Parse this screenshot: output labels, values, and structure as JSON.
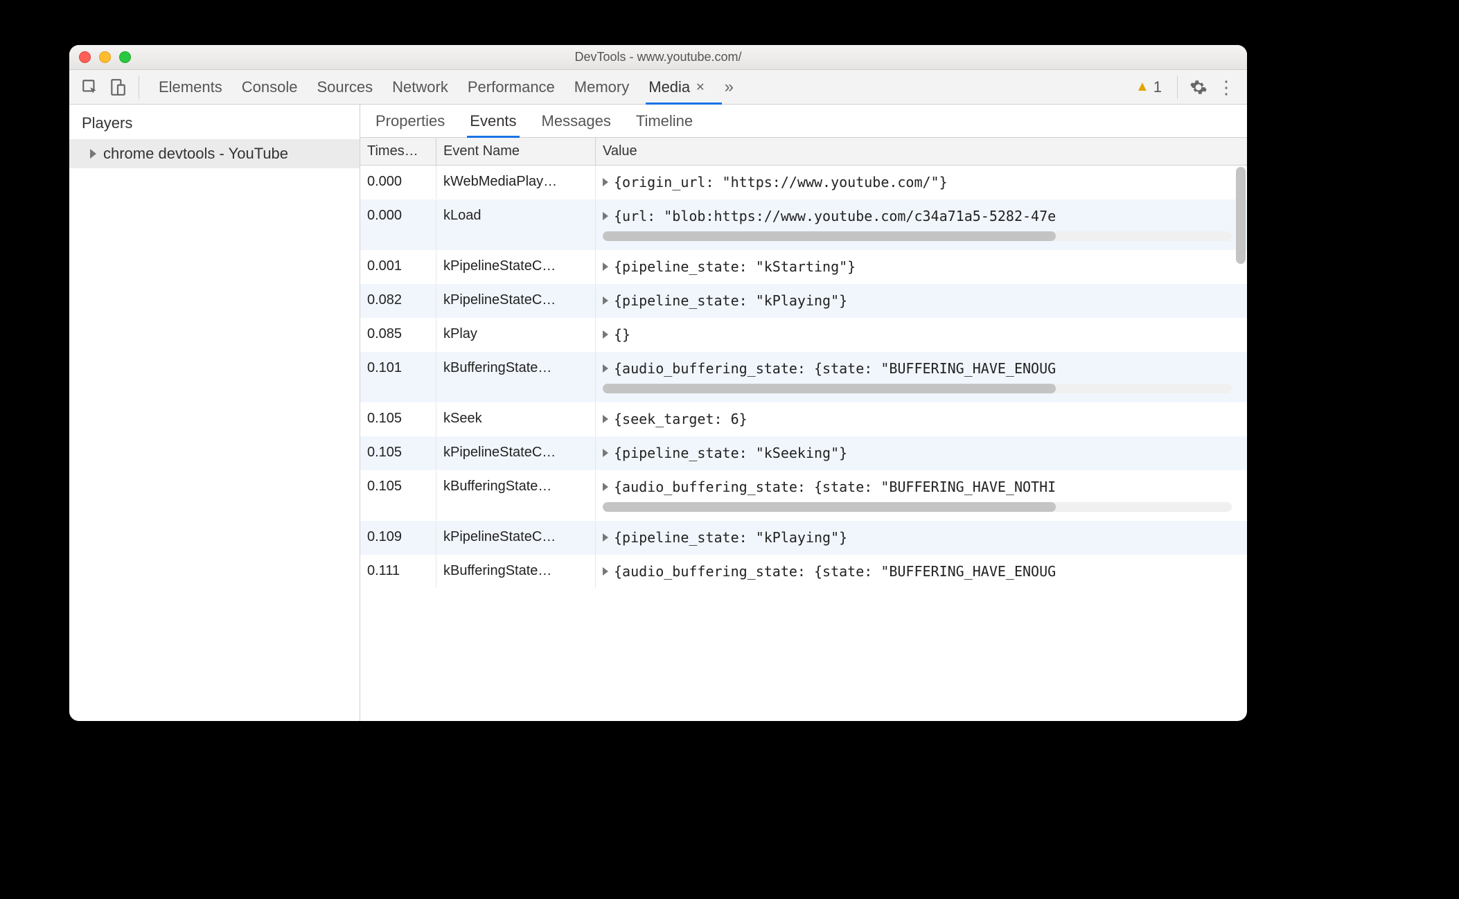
{
  "window": {
    "title": "DevTools - www.youtube.com/"
  },
  "toolbar": {
    "tabs": [
      "Elements",
      "Console",
      "Sources",
      "Network",
      "Performance",
      "Memory",
      "Media"
    ],
    "active_tab": "Media",
    "warning_count": "1"
  },
  "sidebar": {
    "title": "Players",
    "items": [
      {
        "label": "chrome devtools - YouTube"
      }
    ]
  },
  "subtabs": {
    "tabs": [
      "Properties",
      "Events",
      "Messages",
      "Timeline"
    ],
    "active": "Events"
  },
  "table": {
    "headers": {
      "timestamp": "Times…",
      "event": "Event Name",
      "value": "Value"
    },
    "rows": [
      {
        "timestamp": "0.000",
        "event": "kWebMediaPlay…",
        "value": "{origin_url: \"https://www.youtube.com/\"}",
        "overflow": false
      },
      {
        "timestamp": "0.000",
        "event": "kLoad",
        "value": "{url: \"blob:https://www.youtube.com/c34a71a5-5282-47e",
        "overflow": true
      },
      {
        "timestamp": "0.001",
        "event": "kPipelineStateC…",
        "value": "{pipeline_state: \"kStarting\"}",
        "overflow": false
      },
      {
        "timestamp": "0.082",
        "event": "kPipelineStateC…",
        "value": "{pipeline_state: \"kPlaying\"}",
        "overflow": false
      },
      {
        "timestamp": "0.085",
        "event": "kPlay",
        "value": "{}",
        "overflow": false
      },
      {
        "timestamp": "0.101",
        "event": "kBufferingState…",
        "value": "{audio_buffering_state: {state: \"BUFFERING_HAVE_ENOUG",
        "overflow": true
      },
      {
        "timestamp": "0.105",
        "event": "kSeek",
        "value": "{seek_target: 6}",
        "overflow": false
      },
      {
        "timestamp": "0.105",
        "event": "kPipelineStateC…",
        "value": "{pipeline_state: \"kSeeking\"}",
        "overflow": false
      },
      {
        "timestamp": "0.105",
        "event": "kBufferingState…",
        "value": "{audio_buffering_state: {state: \"BUFFERING_HAVE_NOTHI",
        "overflow": true
      },
      {
        "timestamp": "0.109",
        "event": "kPipelineStateC…",
        "value": "{pipeline_state: \"kPlaying\"}",
        "overflow": false
      },
      {
        "timestamp": "0.111",
        "event": "kBufferingState…",
        "value": "{audio_buffering_state: {state: \"BUFFERING_HAVE_ENOUG",
        "overflow": false
      }
    ]
  }
}
